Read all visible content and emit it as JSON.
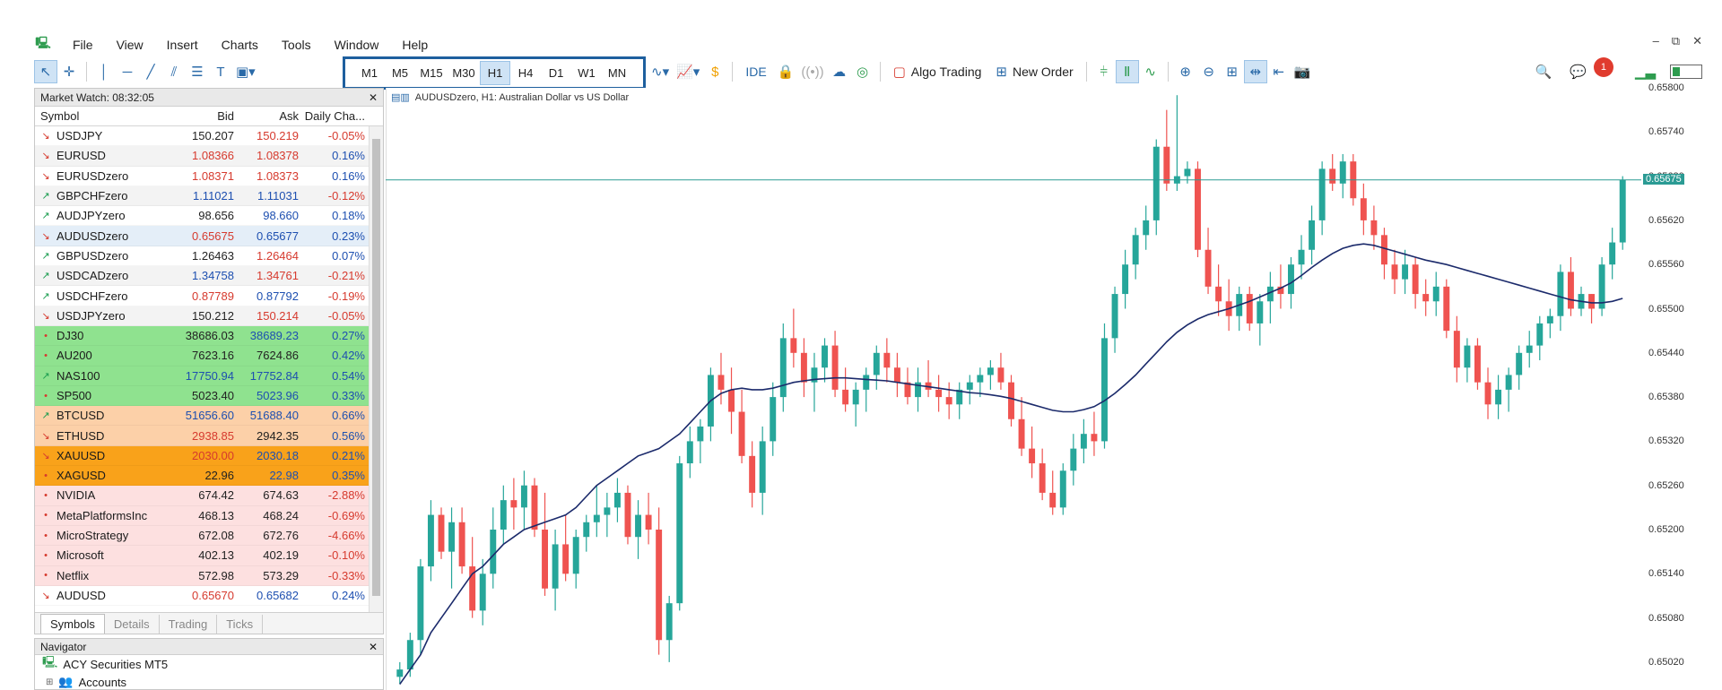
{
  "menubar": {
    "items": [
      "File",
      "View",
      "Insert",
      "Charts",
      "Tools",
      "Window",
      "Help"
    ]
  },
  "toolbar": {
    "timeframes": [
      "M1",
      "M5",
      "M15",
      "M30",
      "H1",
      "H4",
      "D1",
      "W1",
      "MN"
    ],
    "active_timeframe": "H1",
    "ide_label": "IDE",
    "algo_trading_label": "Algo Trading",
    "new_order_label": "New Order",
    "notification_count": "1"
  },
  "market_watch": {
    "title": "Market Watch: 08:32:05",
    "columns": [
      "Symbol",
      "Bid",
      "Ask",
      "Daily Cha..."
    ],
    "rows": [
      {
        "symbol": "USDJPY",
        "bid": "150.207",
        "ask": "150.219",
        "change": "-0.05%",
        "dir": "down",
        "bg": "#ffffff",
        "bidc": "dark",
        "askc": "red"
      },
      {
        "symbol": "EURUSD",
        "bid": "1.08366",
        "ask": "1.08378",
        "change": "0.16%",
        "dir": "down",
        "bg": "#f3f3f3",
        "bidc": "red",
        "askc": "red"
      },
      {
        "symbol": "EURUSDzero",
        "bid": "1.08371",
        "ask": "1.08373",
        "change": "0.16%",
        "dir": "down",
        "bg": "#ffffff",
        "bidc": "red",
        "askc": "red"
      },
      {
        "symbol": "GBPCHFzero",
        "bid": "1.11021",
        "ask": "1.11031",
        "change": "-0.12%",
        "dir": "up",
        "bg": "#f3f3f3",
        "bidc": "blu",
        "askc": "blu"
      },
      {
        "symbol": "AUDJPYzero",
        "bid": "98.656",
        "ask": "98.660",
        "change": "0.18%",
        "dir": "up",
        "bg": "#ffffff",
        "bidc": "dark",
        "askc": "blu"
      },
      {
        "symbol": "AUDUSDzero",
        "bid": "0.65675",
        "ask": "0.65677",
        "change": "0.23%",
        "dir": "down",
        "bg": "#e4eef8",
        "bidc": "red",
        "askc": "blu"
      },
      {
        "symbol": "GBPUSDzero",
        "bid": "1.26463",
        "ask": "1.26464",
        "change": "0.07%",
        "dir": "up",
        "bg": "#ffffff",
        "bidc": "dark",
        "askc": "red"
      },
      {
        "symbol": "USDCADzero",
        "bid": "1.34758",
        "ask": "1.34761",
        "change": "-0.21%",
        "dir": "up",
        "bg": "#f3f3f3",
        "bidc": "blu",
        "askc": "red"
      },
      {
        "symbol": "USDCHFzero",
        "bid": "0.87789",
        "ask": "0.87792",
        "change": "-0.19%",
        "dir": "up",
        "bg": "#ffffff",
        "bidc": "red",
        "askc": "blu"
      },
      {
        "symbol": "USDJPYzero",
        "bid": "150.212",
        "ask": "150.214",
        "change": "-0.05%",
        "dir": "down",
        "bg": "#f3f3f3",
        "bidc": "dark",
        "askc": "red"
      },
      {
        "symbol": "DJ30",
        "bid": "38686.03",
        "ask": "38689.23",
        "change": "0.27%",
        "dir": "dot",
        "bg": "#8fe28f",
        "bidc": "dark",
        "askc": "blu"
      },
      {
        "symbol": "AU200",
        "bid": "7623.16",
        "ask": "7624.86",
        "change": "0.42%",
        "dir": "dot",
        "bg": "#8fe28f",
        "bidc": "dark",
        "askc": "dark"
      },
      {
        "symbol": "NAS100",
        "bid": "17750.94",
        "ask": "17752.84",
        "change": "0.54%",
        "dir": "up",
        "bg": "#8fe28f",
        "bidc": "blu",
        "askc": "blu"
      },
      {
        "symbol": "SP500",
        "bid": "5023.40",
        "ask": "5023.96",
        "change": "0.33%",
        "dir": "dot",
        "bg": "#8fe28f",
        "bidc": "dark",
        "askc": "blu"
      },
      {
        "symbol": "BTCUSD",
        "bid": "51656.60",
        "ask": "51688.40",
        "change": "0.66%",
        "dir": "up",
        "bg": "#fcd0a8",
        "bidc": "blu",
        "askc": "blu"
      },
      {
        "symbol": "ETHUSD",
        "bid": "2938.85",
        "ask": "2942.35",
        "change": "0.56%",
        "dir": "down",
        "bg": "#fcd0a8",
        "bidc": "red",
        "askc": "dark"
      },
      {
        "symbol": "XAUUSD",
        "bid": "2030.00",
        "ask": "2030.18",
        "change": "0.21%",
        "dir": "down",
        "bg": "#f9a21a",
        "bidc": "red",
        "askc": "blu"
      },
      {
        "symbol": "XAGUSD",
        "bid": "22.96",
        "ask": "22.98",
        "change": "0.35%",
        "dir": "dot",
        "bg": "#f9a21a",
        "bidc": "dark",
        "askc": "blu"
      },
      {
        "symbol": "NVIDIA",
        "bid": "674.42",
        "ask": "674.63",
        "change": "-2.88%",
        "dir": "dot",
        "bg": "#fde0e0",
        "bidc": "dark",
        "askc": "dark"
      },
      {
        "symbol": "MetaPlatformsInc",
        "bid": "468.13",
        "ask": "468.24",
        "change": "-0.69%",
        "dir": "dot",
        "bg": "#fde0e0",
        "bidc": "dark",
        "askc": "dark"
      },
      {
        "symbol": "MicroStrategy",
        "bid": "672.08",
        "ask": "672.76",
        "change": "-4.66%",
        "dir": "dot",
        "bg": "#fde0e0",
        "bidc": "dark",
        "askc": "dark"
      },
      {
        "symbol": "Microsoft",
        "bid": "402.13",
        "ask": "402.19",
        "change": "-0.10%",
        "dir": "dot",
        "bg": "#fde0e0",
        "bidc": "dark",
        "askc": "dark"
      },
      {
        "symbol": "Netflix",
        "bid": "572.98",
        "ask": "573.29",
        "change": "-0.33%",
        "dir": "dot",
        "bg": "#fde0e0",
        "bidc": "dark",
        "askc": "dark"
      },
      {
        "symbol": "AUDUSD",
        "bid": "0.65670",
        "ask": "0.65682",
        "change": "0.24%",
        "dir": "down",
        "bg": "#ffffff",
        "bidc": "red",
        "askc": "blu"
      }
    ],
    "tabs": [
      "Symbols",
      "Details",
      "Trading",
      "Ticks"
    ],
    "active_tab": "Symbols"
  },
  "navigator": {
    "title": "Navigator",
    "root": "ACY Securities MT5",
    "accounts": "Accounts"
  },
  "chart": {
    "title": "AUDUSDzero, H1:  Australian Dollar vs US Dollar",
    "current_price": "0.65675",
    "price_ticks": [
      "0.65800",
      "0.65740",
      "0.65680",
      "0.65620",
      "0.65560",
      "0.65500",
      "0.65440",
      "0.65380",
      "0.65320",
      "0.65260",
      "0.65200",
      "0.65140",
      "0.65080",
      "0.65020"
    ],
    "colors": {
      "bull": "#26a69a",
      "bear": "#ef5350",
      "ma": "#1b2a6b",
      "price_line": "#2b9b94"
    }
  },
  "chart_data": {
    "type": "candlestick",
    "symbol": "AUDUSDzero",
    "timeframe": "H1",
    "ylim": [
      0.65,
      0.6582
    ],
    "candles": [
      [
        0.65,
        0.6502,
        0.6499,
        0.6501
      ],
      [
        0.6501,
        0.6506,
        0.65,
        0.6505
      ],
      [
        0.6505,
        0.6516,
        0.6503,
        0.6515
      ],
      [
        0.6515,
        0.6524,
        0.6513,
        0.6522
      ],
      [
        0.6522,
        0.6523,
        0.6516,
        0.6517
      ],
      [
        0.6517,
        0.6523,
        0.6512,
        0.6521
      ],
      [
        0.6521,
        0.6523,
        0.6514,
        0.6515
      ],
      [
        0.6515,
        0.6519,
        0.6508,
        0.6509
      ],
      [
        0.6509,
        0.6516,
        0.6507,
        0.6514
      ],
      [
        0.6514,
        0.6523,
        0.6512,
        0.652
      ],
      [
        0.652,
        0.6526,
        0.6518,
        0.6524
      ],
      [
        0.6524,
        0.6527,
        0.652,
        0.6523
      ],
      [
        0.6523,
        0.6528,
        0.652,
        0.6526
      ],
      [
        0.6526,
        0.6527,
        0.6519,
        0.652
      ],
      [
        0.652,
        0.6525,
        0.6511,
        0.6512
      ],
      [
        0.6512,
        0.652,
        0.6509,
        0.6518
      ],
      [
        0.6518,
        0.6522,
        0.6513,
        0.6514
      ],
      [
        0.6514,
        0.652,
        0.6512,
        0.6519
      ],
      [
        0.6519,
        0.6522,
        0.6517,
        0.6521
      ],
      [
        0.6521,
        0.6526,
        0.6519,
        0.6522
      ],
      [
        0.6522,
        0.6525,
        0.6519,
        0.6523
      ],
      [
        0.6523,
        0.6527,
        0.6521,
        0.6525
      ],
      [
        0.6525,
        0.6526,
        0.6518,
        0.6519
      ],
      [
        0.6519,
        0.6524,
        0.6516,
        0.6522
      ],
      [
        0.6522,
        0.6525,
        0.6518,
        0.652
      ],
      [
        0.652,
        0.6523,
        0.6503,
        0.6505
      ],
      [
        0.6505,
        0.6511,
        0.6502,
        0.651
      ],
      [
        0.651,
        0.653,
        0.6509,
        0.6529
      ],
      [
        0.6529,
        0.6534,
        0.6527,
        0.6532
      ],
      [
        0.6532,
        0.6535,
        0.6529,
        0.6534
      ],
      [
        0.6534,
        0.6542,
        0.6532,
        0.6541
      ],
      [
        0.6541,
        0.6544,
        0.6537,
        0.6539
      ],
      [
        0.6539,
        0.6542,
        0.6533,
        0.6536
      ],
      [
        0.6536,
        0.6539,
        0.6529,
        0.653
      ],
      [
        0.653,
        0.6532,
        0.6523,
        0.6525
      ],
      [
        0.6525,
        0.6534,
        0.6522,
        0.6532
      ],
      [
        0.6532,
        0.654,
        0.653,
        0.6538
      ],
      [
        0.6538,
        0.6548,
        0.6536,
        0.6546
      ],
      [
        0.6546,
        0.655,
        0.6542,
        0.6544
      ],
      [
        0.6544,
        0.6546,
        0.6538,
        0.654
      ],
      [
        0.654,
        0.6544,
        0.6536,
        0.6542
      ],
      [
        0.6542,
        0.6546,
        0.654,
        0.6545
      ],
      [
        0.6545,
        0.6547,
        0.6538,
        0.6539
      ],
      [
        0.6539,
        0.6542,
        0.6536,
        0.6537
      ],
      [
        0.6537,
        0.654,
        0.6534,
        0.6539
      ],
      [
        0.6539,
        0.6542,
        0.6536,
        0.6541
      ],
      [
        0.6541,
        0.6545,
        0.6539,
        0.6544
      ],
      [
        0.6544,
        0.6546,
        0.654,
        0.6542
      ],
      [
        0.6542,
        0.6544,
        0.6538,
        0.654
      ],
      [
        0.654,
        0.6542,
        0.6537,
        0.6538
      ],
      [
        0.6538,
        0.6542,
        0.6536,
        0.654
      ],
      [
        0.654,
        0.6543,
        0.6538,
        0.6539
      ],
      [
        0.6539,
        0.6541,
        0.6536,
        0.6538
      ],
      [
        0.6538,
        0.654,
        0.6535,
        0.6537
      ],
      [
        0.6537,
        0.654,
        0.6535,
        0.6539
      ],
      [
        0.6539,
        0.6541,
        0.6537,
        0.654
      ],
      [
        0.654,
        0.6542,
        0.6538,
        0.6541
      ],
      [
        0.6541,
        0.6543,
        0.6539,
        0.6542
      ],
      [
        0.6542,
        0.6544,
        0.6539,
        0.654
      ],
      [
        0.654,
        0.6541,
        0.6534,
        0.6535
      ],
      [
        0.6535,
        0.6538,
        0.653,
        0.6531
      ],
      [
        0.6531,
        0.6534,
        0.6527,
        0.6529
      ],
      [
        0.6529,
        0.6531,
        0.6524,
        0.6525
      ],
      [
        0.6525,
        0.6528,
        0.6522,
        0.6523
      ],
      [
        0.6523,
        0.6529,
        0.6522,
        0.6528
      ],
      [
        0.6528,
        0.6533,
        0.6526,
        0.6531
      ],
      [
        0.6531,
        0.6535,
        0.6529,
        0.6533
      ],
      [
        0.6533,
        0.6536,
        0.653,
        0.6532
      ],
      [
        0.6532,
        0.6548,
        0.6531,
        0.6546
      ],
      [
        0.6546,
        0.6553,
        0.6544,
        0.6552
      ],
      [
        0.6552,
        0.6558,
        0.655,
        0.6556
      ],
      [
        0.6556,
        0.6561,
        0.6554,
        0.656
      ],
      [
        0.656,
        0.6564,
        0.6558,
        0.6562
      ],
      [
        0.6562,
        0.6573,
        0.656,
        0.6572
      ],
      [
        0.6572,
        0.6577,
        0.6566,
        0.6567
      ],
      [
        0.6567,
        0.6579,
        0.6566,
        0.6568
      ],
      [
        0.6568,
        0.657,
        0.6567,
        0.6569
      ],
      [
        0.6569,
        0.657,
        0.6557,
        0.6558
      ],
      [
        0.6558,
        0.6561,
        0.6552,
        0.6553
      ],
      [
        0.6553,
        0.6556,
        0.6549,
        0.6551
      ],
      [
        0.6551,
        0.6554,
        0.6547,
        0.6549
      ],
      [
        0.6549,
        0.6553,
        0.6547,
        0.6552
      ],
      [
        0.6552,
        0.6553,
        0.6547,
        0.6548
      ],
      [
        0.6548,
        0.6552,
        0.6545,
        0.6551
      ],
      [
        0.6551,
        0.6555,
        0.6548,
        0.6553
      ],
      [
        0.6553,
        0.6556,
        0.655,
        0.6552
      ],
      [
        0.6552,
        0.6557,
        0.655,
        0.6556
      ],
      [
        0.6556,
        0.656,
        0.6554,
        0.6558
      ],
      [
        0.6558,
        0.6564,
        0.6556,
        0.6562
      ],
      [
        0.6562,
        0.657,
        0.656,
        0.6569
      ],
      [
        0.6569,
        0.6571,
        0.6566,
        0.6567
      ],
      [
        0.6567,
        0.6571,
        0.6565,
        0.657
      ],
      [
        0.657,
        0.6571,
        0.6564,
        0.6565
      ],
      [
        0.6565,
        0.6567,
        0.656,
        0.6562
      ],
      [
        0.6562,
        0.6564,
        0.6558,
        0.656
      ],
      [
        0.656,
        0.6561,
        0.6554,
        0.6556
      ],
      [
        0.6556,
        0.6558,
        0.6552,
        0.6554
      ],
      [
        0.6554,
        0.6558,
        0.6552,
        0.6556
      ],
      [
        0.6556,
        0.6557,
        0.655,
        0.6552
      ],
      [
        0.6552,
        0.6554,
        0.6549,
        0.6551
      ],
      [
        0.6551,
        0.6555,
        0.6549,
        0.6553
      ],
      [
        0.6553,
        0.6554,
        0.6546,
        0.6547
      ],
      [
        0.6547,
        0.6549,
        0.654,
        0.6542
      ],
      [
        0.6542,
        0.6546,
        0.654,
        0.6545
      ],
      [
        0.6545,
        0.6546,
        0.6539,
        0.654
      ],
      [
        0.654,
        0.6542,
        0.6535,
        0.6537
      ],
      [
        0.6537,
        0.6541,
        0.6535,
        0.6539
      ],
      [
        0.6539,
        0.6542,
        0.6536,
        0.6541
      ],
      [
        0.6541,
        0.6545,
        0.6539,
        0.6544
      ],
      [
        0.6544,
        0.6547,
        0.6542,
        0.6545
      ],
      [
        0.6545,
        0.6549,
        0.6543,
        0.6548
      ],
      [
        0.6548,
        0.655,
        0.6546,
        0.6549
      ],
      [
        0.6549,
        0.6556,
        0.6547,
        0.6555
      ],
      [
        0.6555,
        0.6557,
        0.6549,
        0.655
      ],
      [
        0.655,
        0.6553,
        0.6549,
        0.6552
      ],
      [
        0.6552,
        0.6552,
        0.6548,
        0.655
      ],
      [
        0.655,
        0.6557,
        0.6549,
        0.6556
      ],
      [
        0.6556,
        0.6561,
        0.6554,
        0.6559
      ],
      [
        0.6559,
        0.6568,
        0.6558,
        0.65675
      ]
    ],
    "moving_average": [
      0.6499,
      0.6501,
      0.6503,
      0.6506,
      0.6508,
      0.651,
      0.6512,
      0.6514,
      0.6515,
      0.65165,
      0.6518,
      0.6519,
      0.652,
      0.65205,
      0.6521,
      0.65215,
      0.6522,
      0.6523,
      0.65245,
      0.6526,
      0.6527,
      0.6528,
      0.6529,
      0.653,
      0.65305,
      0.6531,
      0.6532,
      0.6533,
      0.65345,
      0.6536,
      0.65375,
      0.65385,
      0.6539,
      0.65392,
      0.6539,
      0.6539,
      0.65392,
      0.65396,
      0.654,
      0.65402,
      0.65404,
      0.65405,
      0.65406,
      0.65406,
      0.65405,
      0.65404,
      0.65403,
      0.65402,
      0.654,
      0.65398,
      0.65396,
      0.65394,
      0.65392,
      0.6539,
      0.65388,
      0.65386,
      0.65385,
      0.65383,
      0.65381,
      0.65378,
      0.65374,
      0.6537,
      0.65366,
      0.65362,
      0.6536,
      0.6536,
      0.65363,
      0.65367,
      0.65375,
      0.65385,
      0.65397,
      0.6541,
      0.65425,
      0.6544,
      0.65455,
      0.65468,
      0.65478,
      0.65486,
      0.65492,
      0.65496,
      0.655,
      0.65505,
      0.6551,
      0.65516,
      0.65522,
      0.65528,
      0.65535,
      0.65545,
      0.65556,
      0.65566,
      0.65575,
      0.65582,
      0.65586,
      0.65588,
      0.65586,
      0.65582,
      0.65578,
      0.65574,
      0.6557,
      0.65566,
      0.65563,
      0.6556,
      0.65556,
      0.65552,
      0.65548,
      0.65544,
      0.6554,
      0.65536,
      0.65532,
      0.65528,
      0.65524,
      0.6552,
      0.65516,
      0.65512,
      0.6551,
      0.65508,
      0.65508,
      0.6551,
      0.65514
    ]
  }
}
